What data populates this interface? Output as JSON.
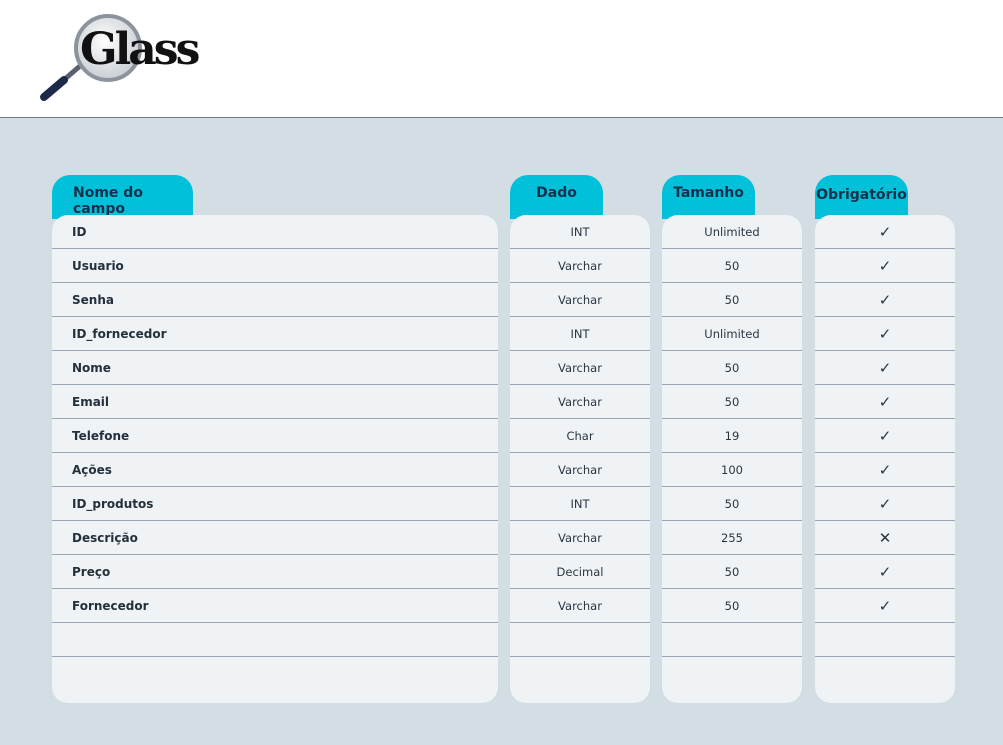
{
  "brand": {
    "logo_text": "Glass",
    "icon": "magnifier-logo-icon"
  },
  "columns": {
    "field_name": "Nome do campo",
    "type": "Dado",
    "size": "Tamanho",
    "required": "Obrigatório"
  },
  "rows": [
    {
      "field": "ID",
      "type": "INT",
      "size": "Unlimited",
      "required": "✓"
    },
    {
      "field": "Usuario",
      "type": "Varchar",
      "size": "50",
      "required": "✓"
    },
    {
      "field": "Senha",
      "type": "Varchar",
      "size": "50",
      "required": "✓"
    },
    {
      "field": "ID_fornecedor",
      "type": "INT",
      "size": "Unlimited",
      "required": "✓"
    },
    {
      "field": "Nome",
      "type": "Varchar",
      "size": "50",
      "required": "✓"
    },
    {
      "field": "Email",
      "type": "Varchar",
      "size": "50",
      "required": "✓"
    },
    {
      "field": "Telefone",
      "type": "Char",
      "size": "19",
      "required": "✓"
    },
    {
      "field": "Ações",
      "type": "Varchar",
      "size": "100",
      "required": "✓"
    },
    {
      "field": "ID_produtos",
      "type": "INT",
      "size": "50",
      "required": "✓"
    },
    {
      "field": "Descrição",
      "type": "Varchar",
      "size": "255",
      "required": "✕"
    },
    {
      "field": "Preço",
      "type": "Decimal",
      "size": "50",
      "required": "✓"
    },
    {
      "field": "Fornecedor",
      "type": "Varchar",
      "size": "50",
      "required": "✓"
    },
    {
      "field": "",
      "type": "",
      "size": "",
      "required": ""
    },
    {
      "field": "",
      "type": "",
      "size": "",
      "required": ""
    }
  ],
  "colors": {
    "tab": "#00c0da",
    "panel": "#eff3f6",
    "background": "#d2dde4"
  }
}
